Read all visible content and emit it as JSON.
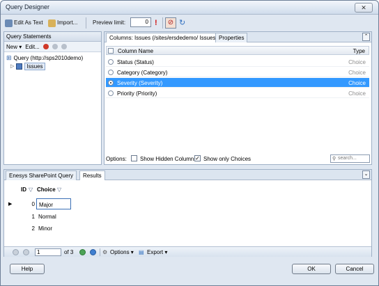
{
  "window": {
    "title": "Query Designer",
    "close_label": "✕"
  },
  "toolbar": {
    "edit_as_text": "Edit As Text",
    "import": "Import...",
    "preview_limit_label": "Preview limit:",
    "preview_limit_value": "0"
  },
  "left": {
    "header": "Query Statements",
    "new_label": "New",
    "edit_label": "Edit...",
    "tree": {
      "query_label": "Query (http://sps2010demo)",
      "list_label": "Issues"
    }
  },
  "right": {
    "tabs": [
      "Columns: Issues (/sites/ersdedemo/ Issues)",
      "Properties"
    ],
    "grid": {
      "headers": [
        "Column Name",
        "Type"
      ],
      "rows": [
        {
          "name": "Status (Status)",
          "type": "Choice",
          "selected": false
        },
        {
          "name": "Category (Category)",
          "type": "Choice",
          "selected": false
        },
        {
          "name": "Severity (Severity)",
          "type": "Choice",
          "selected": true
        },
        {
          "name": "Priority (Priority)",
          "type": "Choice",
          "selected": false
        }
      ]
    },
    "options": {
      "label": "Options:",
      "show_hidden": "Show Hidden Columns",
      "show_only_choices": "Show only Choices",
      "search_placeholder": "search..."
    }
  },
  "bottom": {
    "tabs": [
      "Enesys SharePoint Query",
      "Results"
    ],
    "results": {
      "headers": [
        "ID",
        "Choice"
      ],
      "rows": [
        {
          "id": "0",
          "choice": "Major"
        },
        {
          "id": "1",
          "choice": "Normal"
        },
        {
          "id": "2",
          "choice": "Minor"
        }
      ]
    },
    "pager": {
      "page_value": "1",
      "of_label": "of 3",
      "options_label": "Options",
      "export_label": "Export"
    }
  },
  "footer": {
    "help": "Help",
    "ok": "OK",
    "cancel": "Cancel"
  }
}
